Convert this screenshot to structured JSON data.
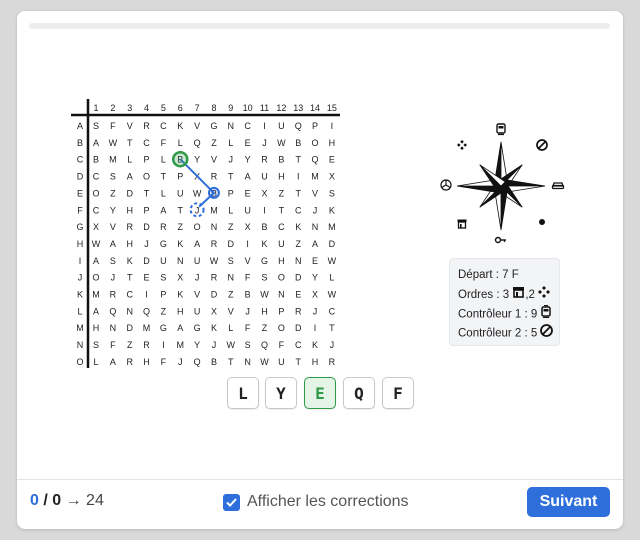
{
  "grid": {
    "columns": [
      "1",
      "2",
      "3",
      "4",
      "5",
      "6",
      "7",
      "8",
      "9",
      "10",
      "11",
      "12",
      "13",
      "14",
      "15"
    ],
    "rows": [
      "A",
      "B",
      "C",
      "D",
      "E",
      "F",
      "G",
      "H",
      "I",
      "J",
      "K",
      "L",
      "M",
      "N",
      "O"
    ],
    "letters": [
      "SFVRCKVGNCIUQPI",
      "AWTCFLQZLEJWBOH",
      "BMLPLBYVJYRBTQE",
      "CSAOTPXRTAUHIMX",
      "OZDTLUWBPEXZTVS",
      "CYHPATJMLUITCJK",
      "XVRDRZONZXBCKNM",
      "WAHJGKARDIKUZAD",
      "ASKDUNUWSVGHNEW",
      "OJTESXJRNFSODYL",
      "MRCIPKVDZBWNEXW",
      "AQNQZHUXVJHPRJC",
      "HNDMGAGKLFZODIT",
      "SFZRIMYJWSQFCKJ",
      "LARHFJQBTNWUTHR"
    ],
    "path": [
      {
        "row": "C",
        "col": "6",
        "state": "correct"
      },
      {
        "row": "E",
        "col": "8",
        "state": "current"
      },
      {
        "row": "F",
        "col": "7",
        "state": "next"
      }
    ],
    "colors": {
      "correct": "#2e9a47",
      "path": "#2f6fdc"
    }
  },
  "compass": {
    "points": [
      {
        "dir": "N",
        "icon": "tram-icon"
      },
      {
        "dir": "NE",
        "icon": "no-entry-icon"
      },
      {
        "dir": "E",
        "icon": "car-icon"
      },
      {
        "dir": "SE",
        "icon": "dot-icon"
      },
      {
        "dir": "S",
        "icon": "key-icon"
      },
      {
        "dir": "SW",
        "icon": "shop-icon"
      },
      {
        "dir": "W",
        "icon": "mercedes-icon"
      },
      {
        "dir": "NW",
        "icon": "diamond-icon"
      }
    ]
  },
  "info": {
    "depart": "Départ : 7 F",
    "ordres_prefix": "Ordres : 3",
    "ordres_mid": ",2",
    "controleur1": "Contrôleur 1 : 9",
    "controleur2": "Contrôleur 2 : 5"
  },
  "answers": [
    {
      "letter": "L",
      "selected": false
    },
    {
      "letter": "Y",
      "selected": false
    },
    {
      "letter": "E",
      "selected": true
    },
    {
      "letter": "Q",
      "selected": false
    },
    {
      "letter": "F",
      "selected": false
    }
  ],
  "footer": {
    "score_current": "0",
    "score_sep": " / ",
    "score_total": "0",
    "score_arrow": " → 24",
    "checkbox_label": "Afficher les corrections",
    "checkbox_checked": true,
    "next_label": "Suivant"
  }
}
